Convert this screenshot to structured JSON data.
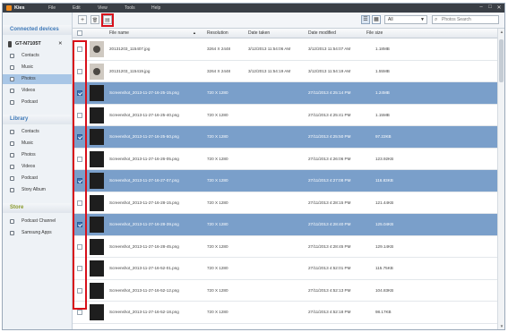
{
  "app": {
    "name": "Kies",
    "menu": [
      "File",
      "Edit",
      "View",
      "Tools",
      "Help"
    ],
    "window_controls": [
      "–",
      "□",
      "✕"
    ]
  },
  "sidebar": {
    "connected_title": "Connected devices",
    "device_name": "GT-N7105T",
    "device_close": "✕",
    "device_items": [
      {
        "label": "Contacts",
        "icon": "contacts-icon"
      },
      {
        "label": "Music",
        "icon": "music-icon"
      },
      {
        "label": "Photos",
        "icon": "photos-icon",
        "active": true
      },
      {
        "label": "Videos",
        "icon": "videos-icon"
      },
      {
        "label": "Podcast",
        "icon": "podcast-icon"
      }
    ],
    "library_title": "Library",
    "library_items": [
      {
        "label": "Contacts",
        "icon": "contacts-icon"
      },
      {
        "label": "Music",
        "icon": "music-icon"
      },
      {
        "label": "Photos",
        "icon": "photos-icon"
      },
      {
        "label": "Videos",
        "icon": "videos-icon"
      },
      {
        "label": "Podcast",
        "icon": "podcast-icon"
      },
      {
        "label": "Story Album",
        "icon": "story-album-icon"
      }
    ],
    "store_title": "Store",
    "store_items": [
      {
        "label": "Podcast Channel",
        "icon": "podcast-channel-icon"
      },
      {
        "label": "Samsung Apps",
        "icon": "samsung-apps-icon"
      }
    ]
  },
  "toolbar": {
    "add_icon": "+",
    "delete_icon": "🗑",
    "export_icon": "▤",
    "filter_value": "All",
    "search_placeholder": "Photos Search",
    "highlight_color": "#d8101a"
  },
  "table": {
    "columns": [
      "File name",
      "Resolution",
      "Date taken",
      "Date modified",
      "File size"
    ],
    "sort_indicator": "▲",
    "rows": [
      {
        "name": "20131203_115407.jpg",
        "res": "3264 X 2448",
        "taken": "3/12/2013 11:54:06 AM",
        "modified": "3/12/2013 11:54:07 AM",
        "size": "1.18MB",
        "checked": false,
        "selected": false,
        "thumb": "photo"
      },
      {
        "name": "20131203_115419.jpg",
        "res": "3264 X 2448",
        "taken": "3/12/2013 11:54:19 AM",
        "modified": "3/12/2013 11:54:19 AM",
        "size": "1.55MB",
        "checked": false,
        "selected": false,
        "thumb": "photo"
      },
      {
        "name": "Screenshot_2013-11-27-16-25-15.png",
        "res": "720 X 1280",
        "taken": "",
        "modified": "27/11/2013 4:25:14 PM",
        "size": "1.24MB",
        "checked": true,
        "selected": true,
        "thumb": "screen"
      },
      {
        "name": "Screenshot_2013-11-27-16-25-40.png",
        "res": "720 X 1280",
        "taken": "",
        "modified": "27/11/2013 4:25:41 PM",
        "size": "1.15MB",
        "checked": false,
        "selected": false,
        "thumb": "screen"
      },
      {
        "name": "Screenshot_2013-11-27-16-25-50.png",
        "res": "720 X 1280",
        "taken": "",
        "modified": "27/11/2013 4:25:50 PM",
        "size": "97.22KB",
        "checked": true,
        "selected": true,
        "thumb": "screen"
      },
      {
        "name": "Screenshot_2013-11-27-16-26-05.png",
        "res": "720 X 1280",
        "taken": "",
        "modified": "27/11/2013 4:26:06 PM",
        "size": "123.92KB",
        "checked": false,
        "selected": false,
        "thumb": "screen"
      },
      {
        "name": "Screenshot_2013-11-27-16-27-07.png",
        "res": "720 X 1280",
        "taken": "",
        "modified": "27/11/2013 4:27:08 PM",
        "size": "116.83KB",
        "checked": true,
        "selected": true,
        "thumb": "screen"
      },
      {
        "name": "Screenshot_2013-11-27-16-28-15.png",
        "res": "720 X 1280",
        "taken": "",
        "modified": "27/11/2013 4:28:15 PM",
        "size": "121.44KB",
        "checked": false,
        "selected": false,
        "thumb": "screen"
      },
      {
        "name": "Screenshot_2013-11-27-16-28-39.png",
        "res": "720 X 1280",
        "taken": "",
        "modified": "27/11/2013 4:28:40 PM",
        "size": "125.04KB",
        "checked": true,
        "selected": true,
        "thumb": "screen"
      },
      {
        "name": "Screenshot_2013-11-27-16-28-45.png",
        "res": "720 X 1280",
        "taken": "",
        "modified": "27/11/2013 4:28:45 PM",
        "size": "129.14KB",
        "checked": false,
        "selected": false,
        "thumb": "screen"
      },
      {
        "name": "Screenshot_2013-11-27-16-52-01.png",
        "res": "720 X 1280",
        "taken": "",
        "modified": "27/11/2013 4:52:01 PM",
        "size": "115.75KB",
        "checked": false,
        "selected": false,
        "thumb": "screen"
      },
      {
        "name": "Screenshot_2013-11-27-16-52-12.png",
        "res": "720 X 1280",
        "taken": "",
        "modified": "27/11/2013 4:52:13 PM",
        "size": "104.83KB",
        "checked": false,
        "selected": false,
        "thumb": "screen"
      },
      {
        "name": "Screenshot_2013-11-27-16-52-18.png",
        "res": "720 X 1280",
        "taken": "",
        "modified": "27/11/2013 4:52:18 PM",
        "size": "98.17KB",
        "checked": false,
        "selected": false,
        "thumb": "screen"
      }
    ]
  }
}
